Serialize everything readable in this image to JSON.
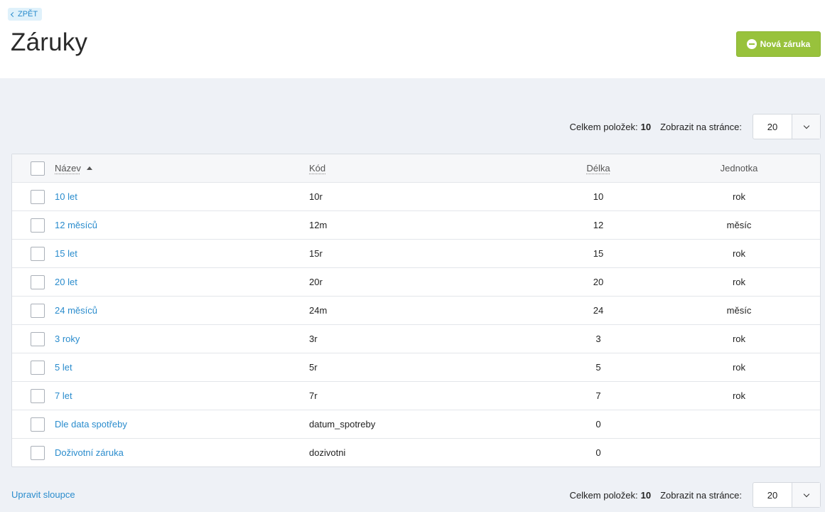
{
  "header": {
    "back_label": "ZPĚT",
    "title": "Záruky",
    "new_button_label": "Nová záruka"
  },
  "pager": {
    "total_label": "Celkem položek:",
    "total_count": "10",
    "per_page_label": "Zobrazit na stránce:",
    "per_page_value": "20"
  },
  "table": {
    "columns": {
      "name": "Název",
      "code": "Kód",
      "length": "Délka",
      "unit": "Jednotka"
    },
    "rows": [
      {
        "name": "10 let",
        "code": "10r",
        "length": "10",
        "unit": "rok"
      },
      {
        "name": "12 měsíců",
        "code": "12m",
        "length": "12",
        "unit": "měsíc"
      },
      {
        "name": "15 let",
        "code": "15r",
        "length": "15",
        "unit": "rok"
      },
      {
        "name": "20 let",
        "code": "20r",
        "length": "20",
        "unit": "rok"
      },
      {
        "name": "24 měsíců",
        "code": "24m",
        "length": "24",
        "unit": "měsíc"
      },
      {
        "name": "3 roky",
        "code": "3r",
        "length": "3",
        "unit": "rok"
      },
      {
        "name": "5 let",
        "code": "5r",
        "length": "5",
        "unit": "rok"
      },
      {
        "name": "7 let",
        "code": "7r",
        "length": "7",
        "unit": "rok"
      },
      {
        "name": "Dle data spotřeby",
        "code": "datum_spotreby",
        "length": "0",
        "unit": ""
      },
      {
        "name": "Doživotní záruka",
        "code": "dozivotni",
        "length": "0",
        "unit": ""
      }
    ]
  },
  "footer": {
    "edit_columns_label": "Upravit sloupce"
  },
  "colors": {
    "accent_green": "#98c23c",
    "link_blue": "#2a8ccd",
    "background": "#eef1f6"
  }
}
